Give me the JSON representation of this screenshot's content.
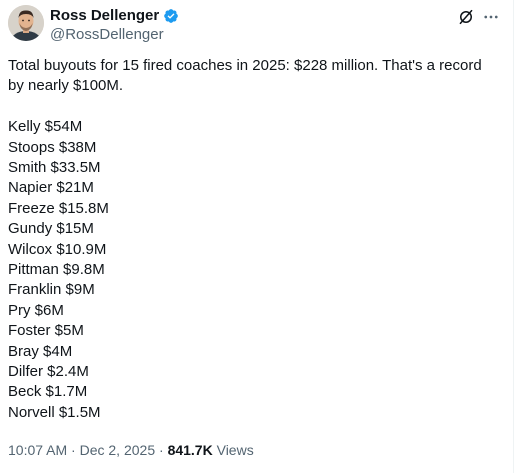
{
  "author": {
    "display_name": "Ross Dellenger",
    "handle": "@RossDellenger",
    "verified": true,
    "verified_color": "#1d9bf0"
  },
  "header_actions": {
    "grok_icon": "grok-icon",
    "more_icon": "more-icon"
  },
  "tweet": {
    "text_intro": "Total buyouts for 15 fired coaches in 2025: $228 million. That's a record by nearly $100M.",
    "list": [
      "Kelly $54M",
      "Stoops $38M",
      "Smith $33.5M",
      "Napier $21M",
      "Freeze $15.8M",
      "Gundy $15M",
      "Wilcox $10.9M",
      "Pittman $9.8M",
      "Franklin $9M",
      "Pry $6M",
      "Foster $5M",
      "Bray $4M",
      "Dilfer $2.4M",
      "Beck $1.7M",
      "Norvell $1.5M"
    ]
  },
  "meta": {
    "time": "10:07 AM",
    "separator": "·",
    "date": "Dec 2, 2025",
    "views_count": "841.7K",
    "views_label": "Views"
  },
  "colors": {
    "text_primary": "#0f1419",
    "text_secondary": "#536471",
    "background": "#ffffff"
  }
}
